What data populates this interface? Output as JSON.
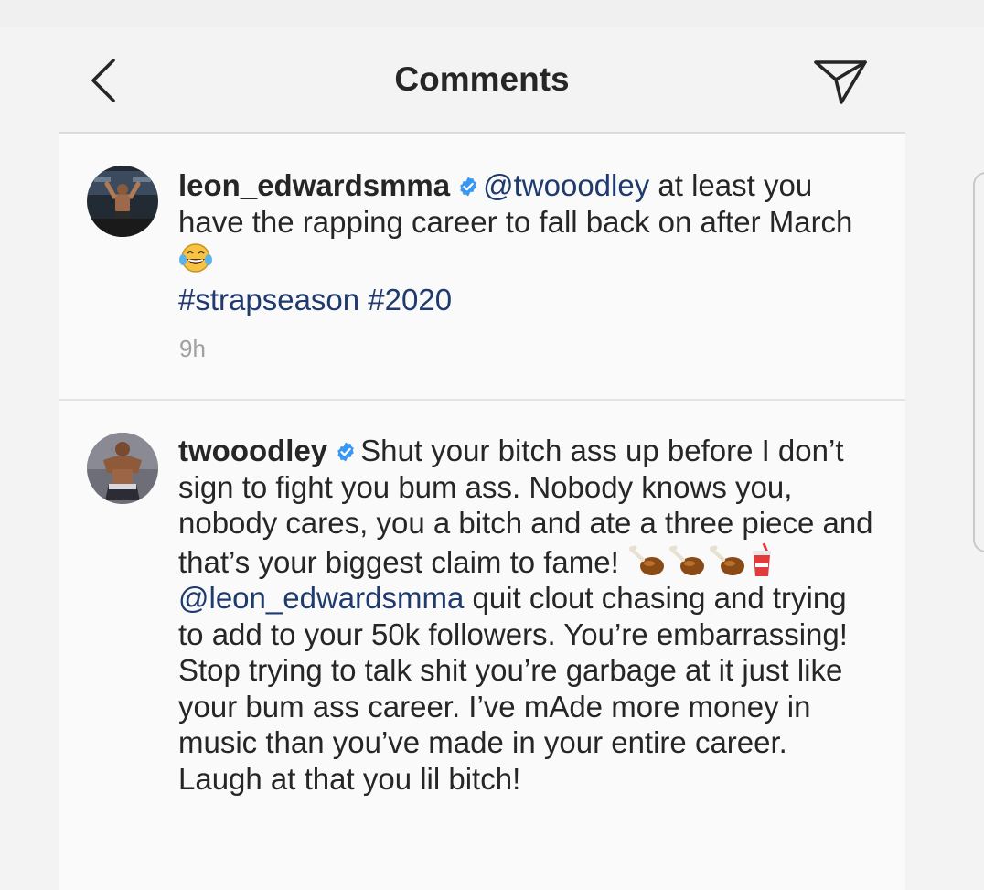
{
  "header": {
    "title": "Comments",
    "back_icon": "chevron-left-icon",
    "send_icon": "paper-plane-icon"
  },
  "comments": [
    {
      "username": "leon_edwardsmma",
      "verified": true,
      "mention": "@twooodley",
      "text": "at least you have the rapping career to fall back on after March",
      "emoji": "face-with-tears-of-joy",
      "hashtags": "#strapseason #2020",
      "timestamp": "9h"
    },
    {
      "username": "twooodley",
      "verified": true,
      "text_before": "Shut your bitch ass up before I don’t sign to fight you bum ass. Nobody knows you, nobody cares, you a bitch and ate a three piece and that’s your biggest claim to fame!",
      "emojis": [
        "poultry-leg",
        "poultry-leg",
        "poultry-leg",
        "cup-with-straw"
      ],
      "mention": "@leon_edwardsmma",
      "text_after": "quit clout chasing and trying to add to your 50k followers. You’re embarrassing! Stop trying to talk shit you’re garbage at it just like your bum ass career. I’ve mAde more money in music than you’ve made in your entire career. Laugh at that you lil bitch!"
    }
  ],
  "colors": {
    "background": "#f3f3f3",
    "panel": "#fafafa",
    "text": "#262626",
    "link": "#1e3a6e",
    "verified": "#3897f0",
    "timestamp": "#a0a0a0"
  }
}
